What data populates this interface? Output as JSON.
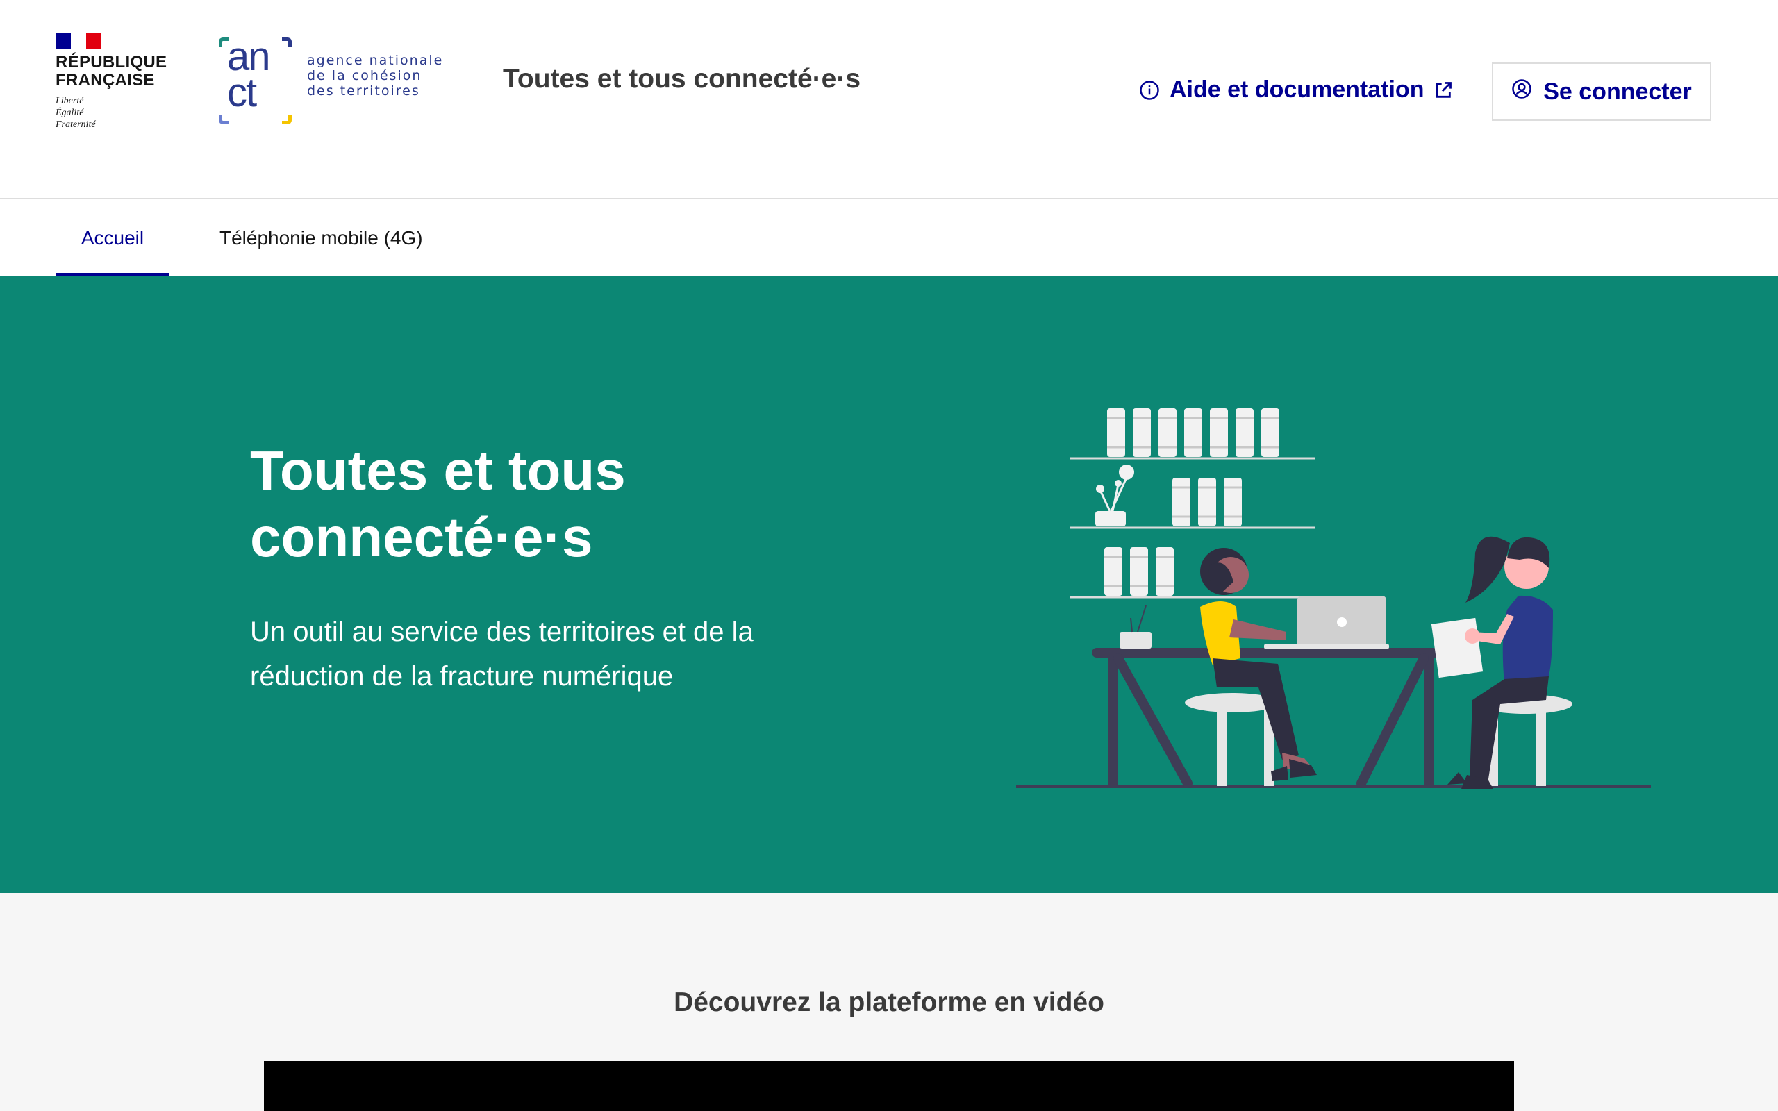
{
  "header": {
    "republic": {
      "name_line1": "RÉPUBLIQUE",
      "name_line2": "FRANÇAISE",
      "motto_1": "Liberté",
      "motto_2": "Égalité",
      "motto_3": "Fraternité"
    },
    "agency": {
      "logo_letters_top": "an",
      "logo_letters_bottom": "ct",
      "line1": "agence nationale",
      "line2": "de la cohésion",
      "line3": "des territoires"
    },
    "site_title": "Toutes et tous connecté·e·s",
    "help_link": {
      "label": "Aide et documentation",
      "icon": "info-icon",
      "external_icon": "external-link-icon"
    },
    "login_button": {
      "label": "Se connecter",
      "icon": "user-icon"
    }
  },
  "nav": {
    "items": [
      {
        "label": "Accueil",
        "active": true
      },
      {
        "label": "Téléphonie mobile (4G)",
        "active": false
      }
    ]
  },
  "hero": {
    "title_line1": "Toutes et tous",
    "title_line2": "connecté·e·s",
    "subtitle_line1": "Un outil au service des territoires et de la",
    "subtitle_line2": "réduction de la fracture numérique",
    "illustration": "people-working-at-desk-illustration"
  },
  "video_section": {
    "title": "Découvrez la plateforme en vidéo"
  },
  "colors": {
    "primary_blue": "#000091",
    "hero_green": "#0c8774",
    "flag_red": "#e1000f",
    "anct_blue": "#2b3a8c",
    "anct_yellow": "#f5c400"
  }
}
